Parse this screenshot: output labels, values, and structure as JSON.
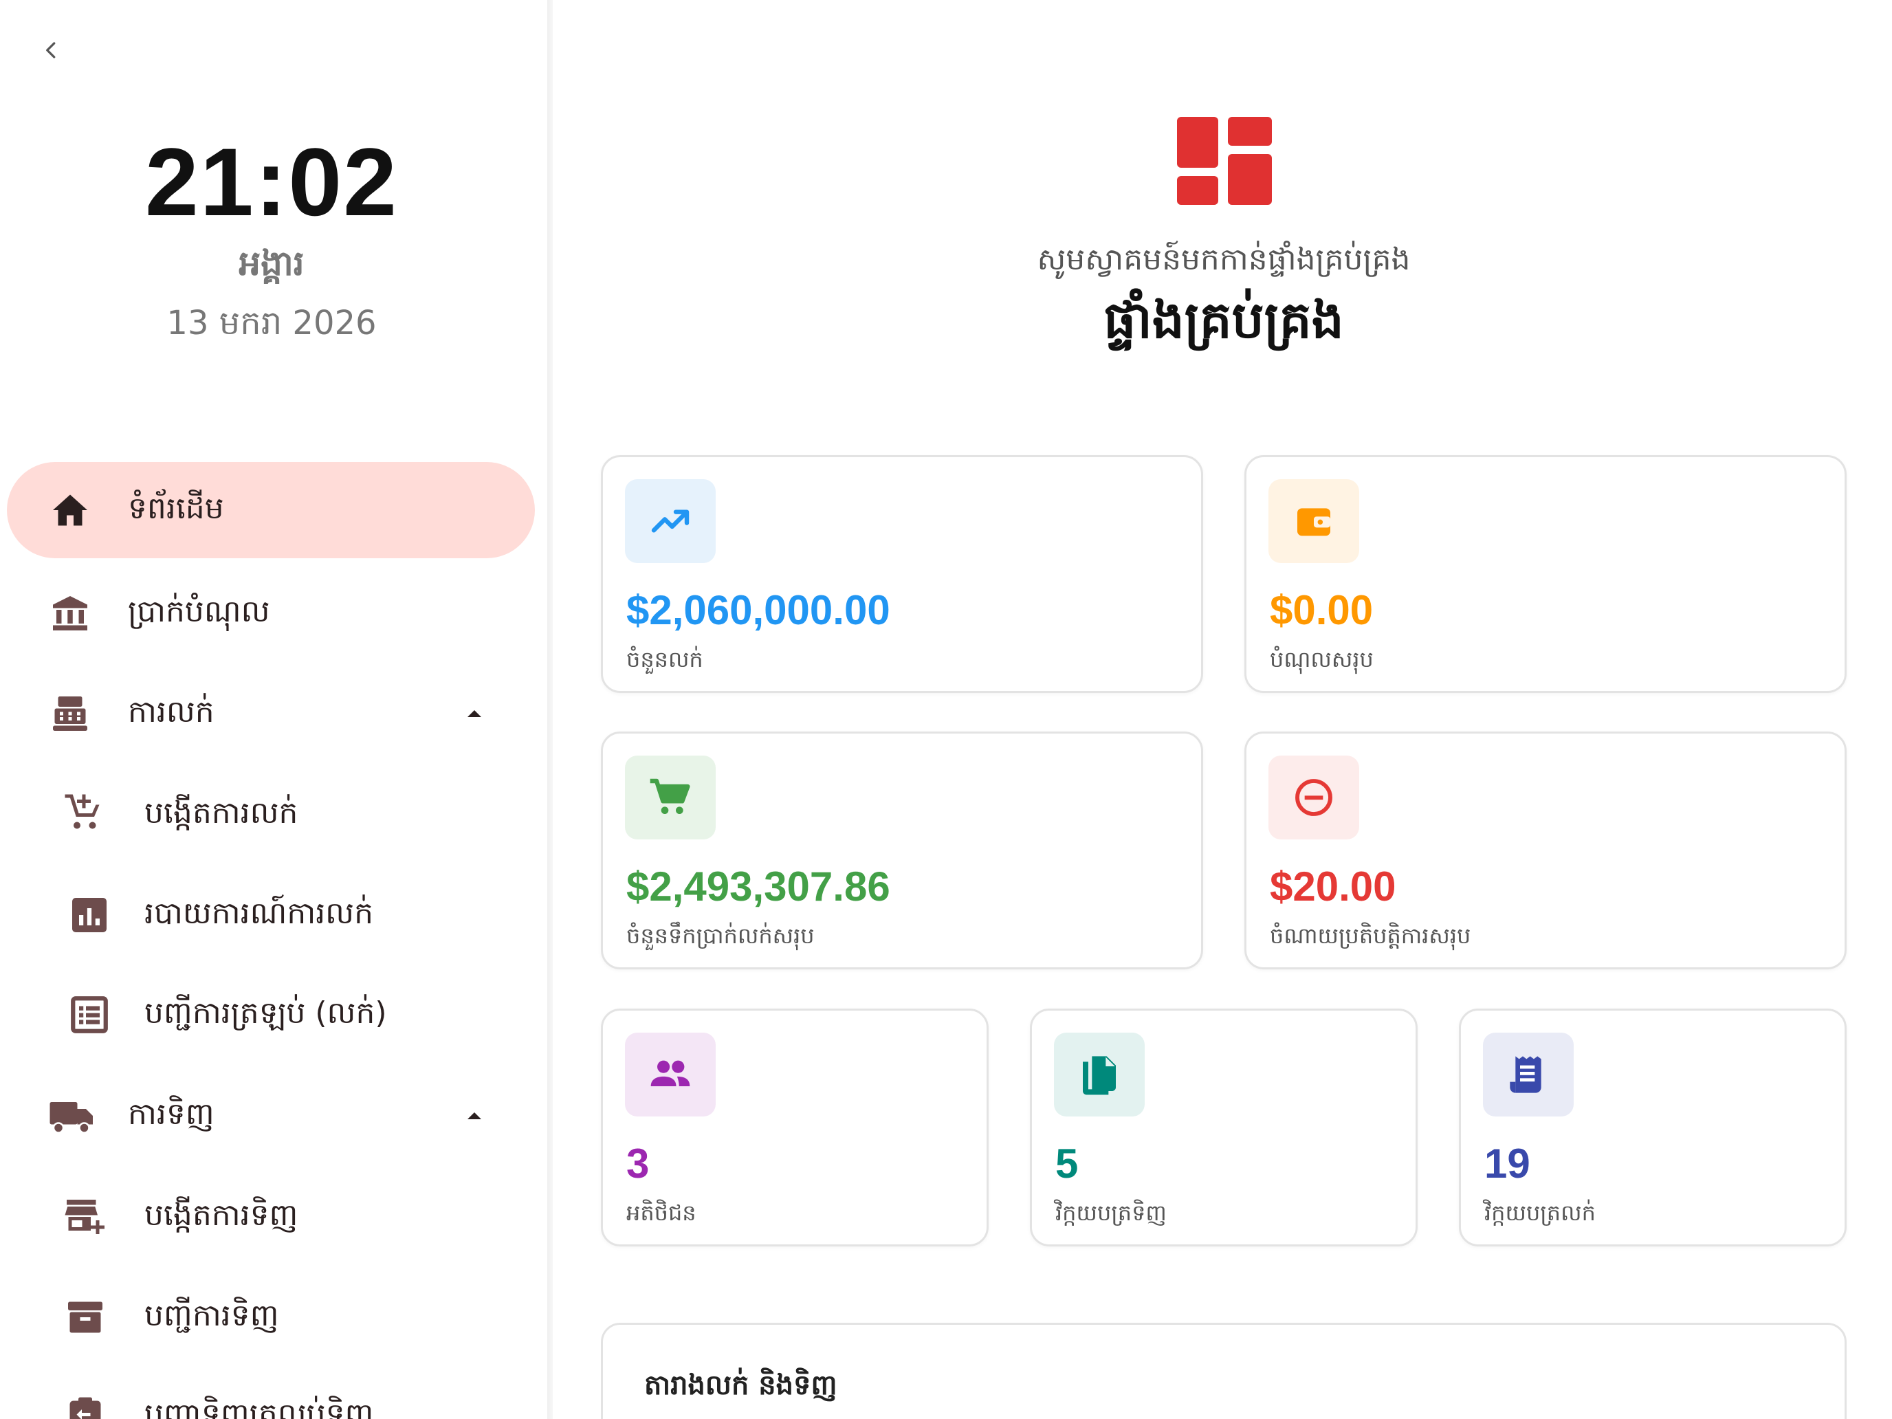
{
  "sidebar": {
    "clock": "21:02",
    "weekday": "អង្គារ",
    "date": "13 មករា 2026",
    "items": [
      {
        "label": "ទំព័រដើម",
        "icon": "home-icon",
        "active": true
      },
      {
        "label": "ប្រាក់បំណុល",
        "icon": "bank-icon"
      },
      {
        "label": "ការលក់",
        "icon": "cash-register-icon",
        "expanded": true
      },
      {
        "label": "បង្កើតការលក់",
        "icon": "add-cart-icon"
      },
      {
        "label": "របាយការណ៍ការលក់",
        "icon": "report-chart-icon"
      },
      {
        "label": "បញ្ជីការត្រឡប់ (លក់)",
        "icon": "list-icon"
      },
      {
        "label": "ការទិញ",
        "icon": "truck-icon",
        "expanded": true
      },
      {
        "label": "បង្កើតការទិញ",
        "icon": "add-store-icon"
      },
      {
        "label": "បញ្ជីការទិញ",
        "icon": "archive-box-icon"
      },
      {
        "label": "បញ្ជាទិញត្រលប់ទិញ",
        "icon": "return-clipboard-icon"
      }
    ]
  },
  "header": {
    "welcome": "សូមស្វាគមន៍មកកាន់ផ្ទាំងគ្រប់គ្រង",
    "title": "ផ្ទាំងគ្រប់គ្រង"
  },
  "stats": [
    {
      "value": "$2,060,000.00",
      "label": "ចំនួនលក់",
      "color": "#2196f3",
      "badge": "#e6f2fc",
      "icon": "trending-up-icon"
    },
    {
      "value": "$0.00",
      "label": "បំណុលសរុប",
      "color": "#ff9800",
      "badge": "#fff3e3",
      "icon": "wallet-icon"
    },
    {
      "value": "$2,493,307.86",
      "label": "ចំនួនទឹកប្រាក់លក់សរុប",
      "color": "#43a047",
      "badge": "#e8f4e8",
      "icon": "shopping-cart-icon"
    },
    {
      "value": "$20.00",
      "label": "ចំណាយប្រតិបត្តិការសរុប",
      "color": "#e53935",
      "badge": "#fdeceb",
      "icon": "minus-circle-icon"
    },
    {
      "value": "3",
      "label": "អតិថិជន",
      "color": "#9c27b0",
      "badge": "#f4e6f6",
      "icon": "people-icon"
    },
    {
      "value": "5",
      "label": "វិក្កយបត្រទិញ",
      "color": "#00897b",
      "badge": "#e3f2f0",
      "icon": "documents-icon"
    },
    {
      "value": "19",
      "label": "វិក្កយបត្រលក់",
      "color": "#3949ab",
      "badge": "#e9ebf6",
      "icon": "receipt-icon"
    }
  ],
  "table_section": {
    "title": "តារាងលក់ និងទិញ"
  },
  "colors": {
    "accent": "#e03131",
    "active_bg": "#ffdcd8",
    "icon_brown": "#6d4c4c"
  }
}
